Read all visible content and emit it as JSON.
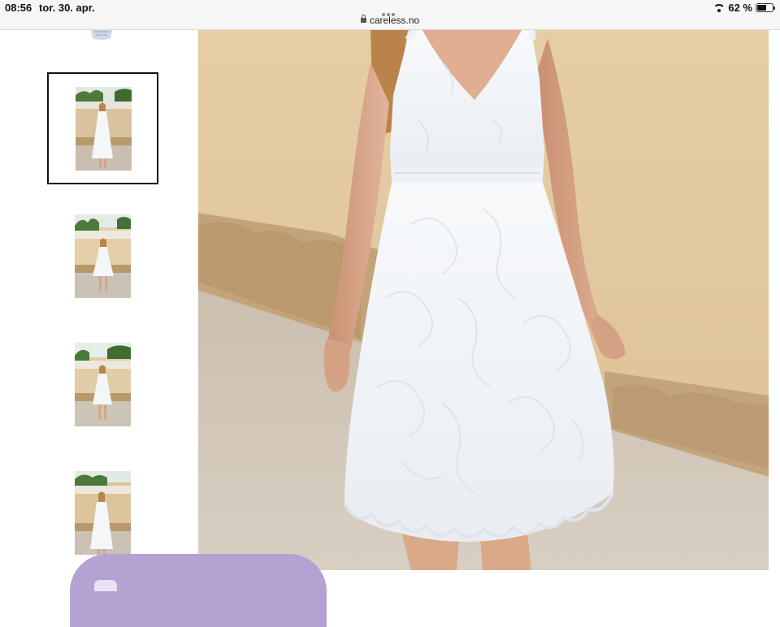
{
  "status_bar": {
    "time": "08:56",
    "date": "tor. 30. apr.",
    "url": "careless.no",
    "battery_text": "62 %",
    "battery_level": 0.62,
    "icons": [
      "wifi-icon",
      "battery-icon",
      "lock-icon",
      "more-dots-icon"
    ]
  },
  "gallery": {
    "thumbnail_count": 5,
    "selected_index": 1
  },
  "colors": {
    "accent_bubble": "#b3a2d2",
    "thumb_border": "#111111"
  }
}
